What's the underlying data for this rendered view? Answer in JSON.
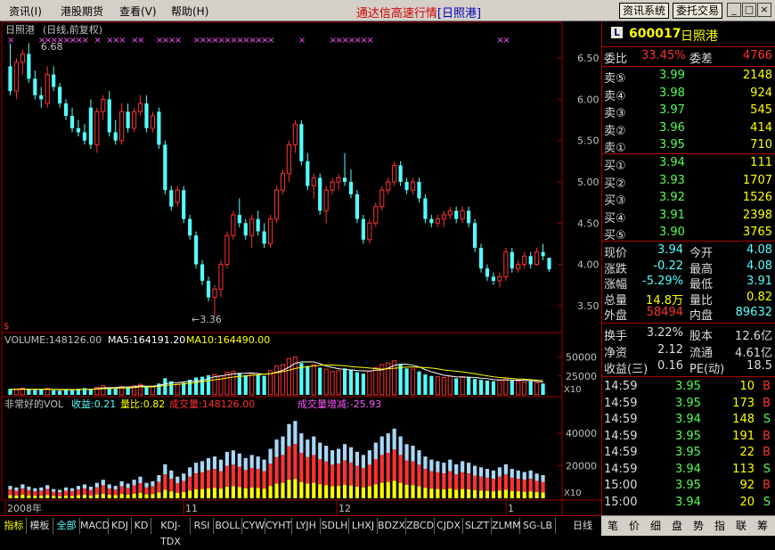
{
  "menu": {
    "items": [
      "资讯(I)",
      "港股期货",
      "查看(V)",
      "帮助(H)"
    ],
    "title_prefix": "通达信高速行情",
    "title_suffix": "[日照港]",
    "btn_info": "资讯系统",
    "btn_trade": "委托交易",
    "win_min": "_",
    "win_max": "□",
    "win_close": "×"
  },
  "chart_header": {
    "name": "日照港",
    "mode": "(日线,前复权)",
    "high_label": "6.68",
    "low_label": "←3.36",
    "s_marker": "$"
  },
  "vol_header": {
    "volume": "VOLUME:148126.00",
    "ma5": "MA5:164191.20",
    "ma10": "MA10:164490.00",
    "x10": "X10"
  },
  "vol2_header": {
    "name": "非常好的VOL",
    "recv": "收益:0.21",
    "ratio": "量比:0.82",
    "turnover": "成交量:148126.00",
    "change": "成交量增减:-25.93",
    "x10": "X10"
  },
  "colors": {
    "up": "#ff3232",
    "down": "#54ffff",
    "ma5": "#ffffff",
    "ma10": "#ffff00",
    "grid": "#a00000",
    "axis_text": "#c0c0c0",
    "yellow": "#ffff00",
    "red": "#ff3232",
    "cyan_light": "#a8d8f8"
  },
  "chart_data": [
    {
      "type": "candlestick",
      "title": "日照港 (日线,前复权)",
      "ylim": [
        3.25,
        6.75
      ],
      "yticks": [
        3.5,
        4.0,
        4.5,
        5.0,
        5.5,
        6.0,
        6.5
      ],
      "xlabels": [
        "2008年",
        "11",
        "12",
        "1"
      ],
      "ohlc": [
        [
          6.4,
          6.68,
          6.05,
          6.1
        ],
        [
          6.1,
          6.5,
          6.0,
          6.45
        ],
        [
          6.45,
          6.6,
          6.3,
          6.55
        ],
        [
          6.55,
          6.68,
          6.2,
          6.25
        ],
        [
          6.25,
          6.35,
          6.0,
          6.05
        ],
        [
          6.05,
          6.15,
          5.9,
          6.0
        ],
        [
          5.95,
          6.4,
          5.9,
          6.3
        ],
        [
          6.3,
          6.4,
          6.1,
          6.15
        ],
        [
          6.15,
          6.2,
          5.9,
          5.95
        ],
        [
          5.95,
          6.0,
          5.75,
          5.8
        ],
        [
          5.8,
          5.9,
          5.6,
          5.65
        ],
        [
          5.65,
          5.75,
          5.55,
          5.6
        ],
        [
          5.6,
          5.7,
          5.45,
          5.5
        ],
        [
          5.9,
          6.0,
          5.4,
          5.45
        ],
        [
          5.45,
          5.9,
          5.35,
          5.85
        ],
        [
          5.85,
          6.05,
          5.75,
          6.0
        ],
        [
          6.0,
          6.1,
          5.55,
          5.6
        ],
        [
          5.6,
          5.75,
          5.45,
          5.5
        ],
        [
          5.5,
          5.95,
          5.45,
          5.85
        ],
        [
          5.85,
          5.95,
          5.6,
          5.65
        ],
        [
          5.65,
          5.9,
          5.6,
          5.85
        ],
        [
          5.85,
          6.05,
          5.8,
          5.95
        ],
        [
          5.95,
          6.05,
          5.6,
          5.65
        ],
        [
          5.65,
          5.85,
          5.6,
          5.8
        ],
        [
          5.85,
          5.9,
          5.4,
          5.45
        ],
        [
          5.45,
          5.5,
          4.85,
          4.9
        ],
        [
          4.9,
          4.95,
          4.65,
          4.7
        ],
        [
          4.75,
          4.95,
          4.7,
          4.9
        ],
        [
          4.9,
          4.95,
          4.5,
          4.55
        ],
        [
          4.55,
          4.6,
          4.3,
          4.35
        ],
        [
          4.35,
          4.4,
          3.95,
          4.0
        ],
        [
          4.0,
          4.05,
          3.75,
          3.8
        ],
        [
          3.8,
          3.85,
          3.55,
          3.6
        ],
        [
          3.6,
          3.75,
          3.36,
          3.7
        ],
        [
          3.7,
          4.05,
          3.6,
          4.0
        ],
        [
          4.0,
          4.4,
          3.95,
          4.35
        ],
        [
          4.35,
          4.65,
          4.3,
          4.6
        ],
        [
          4.6,
          4.8,
          4.45,
          4.5
        ],
        [
          4.5,
          4.55,
          4.3,
          4.35
        ],
        [
          4.35,
          4.6,
          4.2,
          4.55
        ],
        [
          4.55,
          4.65,
          4.35,
          4.4
        ],
        [
          4.4,
          4.5,
          4.2,
          4.25
        ],
        [
          4.25,
          4.6,
          4.2,
          4.55
        ],
        [
          4.55,
          4.95,
          4.5,
          4.9
        ],
        [
          4.9,
          5.15,
          4.85,
          5.1
        ],
        [
          5.1,
          5.5,
          5.0,
          5.45
        ],
        [
          5.45,
          5.75,
          5.35,
          5.7
        ],
        [
          5.7,
          5.75,
          5.2,
          5.25
        ],
        [
          5.25,
          5.35,
          4.9,
          4.95
        ],
        [
          4.95,
          5.1,
          4.8,
          5.05
        ],
        [
          5.05,
          5.1,
          4.6,
          4.65
        ],
        [
          4.65,
          4.95,
          4.5,
          4.9
        ],
        [
          4.9,
          5.05,
          4.85,
          5.0
        ],
        [
          5.0,
          5.1,
          4.9,
          5.05
        ],
        [
          5.05,
          5.35,
          4.95,
          5.0
        ],
        [
          5.0,
          5.15,
          4.8,
          4.85
        ],
        [
          4.85,
          4.9,
          4.5,
          4.55
        ],
        [
          4.55,
          4.6,
          4.25,
          4.3
        ],
        [
          4.3,
          4.55,
          4.25,
          4.5
        ],
        [
          4.5,
          4.75,
          4.45,
          4.7
        ],
        [
          4.7,
          4.95,
          4.65,
          4.9
        ],
        [
          4.9,
          5.05,
          4.85,
          5.0
        ],
        [
          5.0,
          5.25,
          4.95,
          5.2
        ],
        [
          5.2,
          5.25,
          4.95,
          5.0
        ],
        [
          5.0,
          5.05,
          4.85,
          4.9
        ],
        [
          4.9,
          5.05,
          4.85,
          5.0
        ],
        [
          5.0,
          5.05,
          4.75,
          4.8
        ],
        [
          4.8,
          4.85,
          4.5,
          4.55
        ],
        [
          4.55,
          4.6,
          4.45,
          4.5
        ],
        [
          4.5,
          4.6,
          4.45,
          4.55
        ],
        [
          4.55,
          4.65,
          4.45,
          4.6
        ],
        [
          4.6,
          4.7,
          4.55,
          4.65
        ],
        [
          4.65,
          4.7,
          4.5,
          4.55
        ],
        [
          4.55,
          4.7,
          4.5,
          4.65
        ],
        [
          4.65,
          4.7,
          4.45,
          4.5
        ],
        [
          4.5,
          4.55,
          4.15,
          4.2
        ],
        [
          4.2,
          4.25,
          3.9,
          3.95
        ],
        [
          3.95,
          4.0,
          3.8,
          3.85
        ],
        [
          3.85,
          3.9,
          3.75,
          3.8
        ],
        [
          3.8,
          3.9,
          3.72,
          3.85
        ],
        [
          3.85,
          4.2,
          3.8,
          4.15
        ],
        [
          4.15,
          4.2,
          3.9,
          3.95
        ],
        [
          3.95,
          4.05,
          3.9,
          4.0
        ],
        [
          4.0,
          4.15,
          3.95,
          4.1
        ],
        [
          4.1,
          4.15,
          3.95,
          4.0
        ],
        [
          4.0,
          4.2,
          3.98,
          4.15
        ],
        [
          4.15,
          4.25,
          4.05,
          4.1
        ],
        [
          4.08,
          4.08,
          3.91,
          3.94
        ]
      ]
    },
    {
      "type": "bar",
      "name": "VOLUME",
      "yticks": [
        25000,
        50000
      ],
      "ylim": [
        0,
        60000
      ],
      "values": [
        8000,
        7000,
        9000,
        7500,
        6500,
        7000,
        8500,
        6000,
        5500,
        7000,
        6500,
        8000,
        9000,
        7500,
        10000,
        12000,
        9000,
        8000,
        11000,
        9500,
        12000,
        14000,
        10000,
        11000,
        15000,
        22000,
        18000,
        14000,
        16000,
        20000,
        23000,
        24000,
        26000,
        27000,
        25000,
        30000,
        31000,
        29000,
        26000,
        28000,
        27000,
        25000,
        32000,
        38000,
        40000,
        48000,
        50000,
        42000,
        38000,
        40000,
        36000,
        34000,
        31000,
        32000,
        35000,
        33000,
        30000,
        28000,
        31000,
        36000,
        40000,
        42000,
        45000,
        40000,
        35000,
        34000,
        31000,
        27000,
        25000,
        24000,
        23000,
        25000,
        22000,
        24000,
        23000,
        21000,
        20000,
        19000,
        18000,
        20000,
        22000,
        19000,
        18000,
        17000,
        18000,
        16000,
        15000
      ],
      "ma5": [
        7400,
        7600,
        7800,
        7500,
        7400,
        7300,
        7700,
        7100,
        6700,
        6900,
        6800,
        7000,
        7300,
        7300,
        8300,
        9300,
        9600,
        9800,
        10500,
        10400,
        10800,
        12000,
        11400,
        11500,
        12400,
        14600,
        16000,
        16200,
        17000,
        18000,
        18200,
        19200,
        21400,
        24000,
        25000,
        26400,
        27800,
        28200,
        28600,
        28800,
        28200,
        27000,
        28000,
        30000,
        32400,
        36600,
        41600,
        43600,
        43600,
        43600,
        41200,
        38000,
        36200,
        34600,
        33600,
        33000,
        32200,
        31800,
        31400,
        32600,
        33000,
        35400,
        38800,
        40600,
        40400,
        39200,
        37000,
        33400,
        30400,
        28200,
        26000,
        24800,
        23800,
        23600,
        23400,
        23000,
        22000,
        21400,
        20200,
        19600,
        19800,
        19600,
        19400,
        19200,
        18800,
        18000,
        16800
      ],
      "ma10": [
        7200,
        7300,
        7400,
        7400,
        7300,
        7300,
        7500,
        7300,
        7200,
        7200,
        7100,
        7200,
        7300,
        7300,
        7600,
        8200,
        8400,
        8600,
        9000,
        9200,
        9600,
        10700,
        10600,
        10600,
        11300,
        12400,
        13300,
        13800,
        14500,
        15300,
        16200,
        17500,
        18700,
        20000,
        20900,
        22300,
        23600,
        24400,
        25000,
        25800,
        26600,
        27200,
        28100,
        29300,
        30700,
        32600,
        34900,
        36300,
        37300,
        38300,
        39000,
        39300,
        39400,
        39000,
        38600,
        37400,
        36700,
        36200,
        35400,
        34700,
        34000,
        34500,
        35200,
        35900,
        36800,
        36700,
        36400,
        36100,
        35500,
        34400,
        33000,
        32000,
        31300,
        30300,
        29100,
        27900,
        26500,
        25200,
        23900,
        22900,
        22300,
        21600,
        21000,
        20700,
        20200,
        19500,
        18700
      ]
    },
    {
      "type": "bar",
      "name": "非常好的VOL",
      "yticks": [
        20000,
        40000
      ],
      "ylim": [
        0,
        52000
      ]
    }
  ],
  "sidebar": {
    "code": "600017",
    "name": "日照港",
    "logo": "L",
    "wb": {
      "label": "委比",
      "value": "33.45%",
      "label2": "委差",
      "value2": "4766"
    },
    "asks": [
      {
        "label": "卖⑤",
        "price": "3.99",
        "vol": "2148"
      },
      {
        "label": "卖④",
        "price": "3.98",
        "vol": "924"
      },
      {
        "label": "卖③",
        "price": "3.97",
        "vol": "545"
      },
      {
        "label": "卖②",
        "price": "3.96",
        "vol": "414"
      },
      {
        "label": "卖①",
        "price": "3.95",
        "vol": "710"
      }
    ],
    "bids": [
      {
        "label": "买①",
        "price": "3.94",
        "vol": "111"
      },
      {
        "label": "买②",
        "price": "3.93",
        "vol": "1707"
      },
      {
        "label": "买③",
        "price": "3.92",
        "vol": "1526"
      },
      {
        "label": "买④",
        "price": "3.91",
        "vol": "2398"
      },
      {
        "label": "买⑤",
        "price": "3.90",
        "vol": "3765"
      }
    ],
    "quote": [
      {
        "l1": "现价",
        "v1": "3.94",
        "l2": "今开",
        "v2": "4.08",
        "c1": "#54ffff",
        "c2": "#54ffff"
      },
      {
        "l1": "涨跌",
        "v1": "-0.22",
        "l2": "最高",
        "v2": "4.08",
        "c1": "#54ffff",
        "c2": "#54ffff"
      },
      {
        "l1": "涨幅",
        "v1": "-5.29%",
        "l2": "最低",
        "v2": "3.91",
        "c1": "#54ffff",
        "c2": "#54ffff"
      },
      {
        "l1": "总量",
        "v1": "14.8万",
        "l2": "量比",
        "v2": "0.82",
        "c1": "#ffff00",
        "c2": "#ffff00"
      },
      {
        "l1": "外盘",
        "v1": "58494",
        "l2": "内盘",
        "v2": "89632",
        "c1": "#ff3232",
        "c2": "#54ffff"
      }
    ],
    "fund": [
      {
        "l1": "换手",
        "v1": "3.22%",
        "l2": "股本",
        "v2": "12.6亿"
      },
      {
        "l1": "净资",
        "v1": "2.12",
        "l2": "流通",
        "v2": "4.61亿"
      },
      {
        "l1": "收益(三)",
        "v1": "0.16",
        "l2": "PE(动)",
        "v2": "18.5"
      }
    ],
    "ticks": [
      {
        "time": "14:59",
        "price": "3.95",
        "vol": "10",
        "side": "B"
      },
      {
        "time": "14:59",
        "price": "3.95",
        "vol": "173",
        "side": "B"
      },
      {
        "time": "14:59",
        "price": "3.94",
        "vol": "148",
        "side": "S"
      },
      {
        "time": "14:59",
        "price": "3.95",
        "vol": "191",
        "side": "B"
      },
      {
        "time": "14:59",
        "price": "3.95",
        "vol": "22",
        "side": "B"
      },
      {
        "time": "14:59",
        "price": "3.94",
        "vol": "113",
        "side": "S"
      },
      {
        "time": "15:00",
        "price": "3.95",
        "vol": "92",
        "side": "B"
      },
      {
        "time": "15:00",
        "price": "3.94",
        "vol": "20",
        "side": "S"
      }
    ]
  },
  "tabs": [
    "指标",
    "模板",
    "全部",
    "MACD",
    "KDJ",
    "KD",
    "KDJ-TDX",
    "RSI",
    "BOLL",
    "CYW",
    "CYHT",
    "LYJH",
    "SDLH",
    "LHXJ",
    "BDZX",
    "ZBCD",
    "CJDX",
    "SLZT",
    "ZLMM",
    "SG-LB"
  ],
  "period_label": "日线",
  "tabs2": [
    "笔",
    "价",
    "细",
    "盘",
    "势",
    "指",
    "联",
    "筹"
  ]
}
